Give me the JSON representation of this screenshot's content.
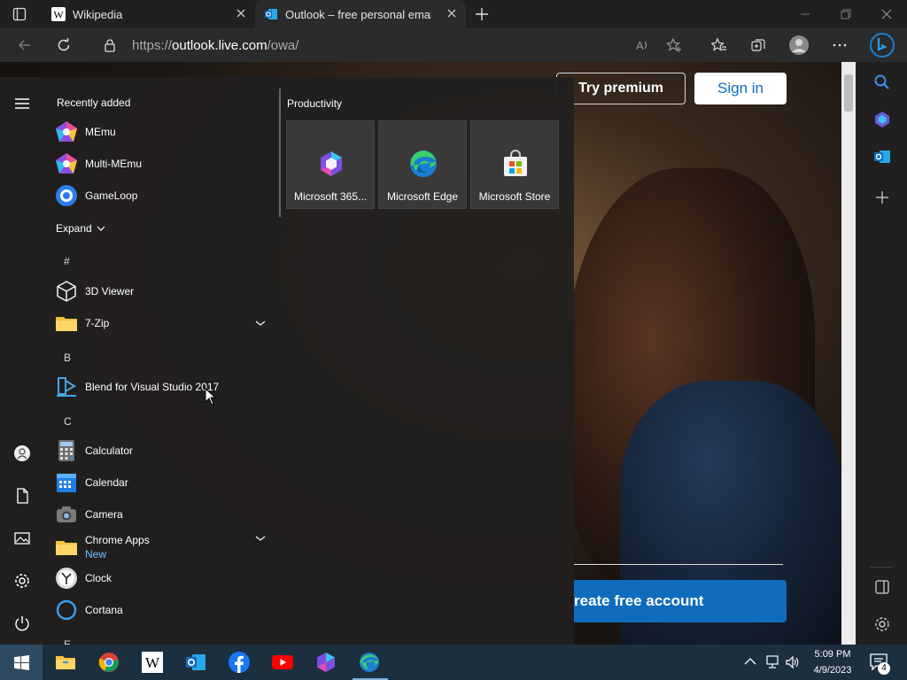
{
  "browser": {
    "tabs": [
      {
        "label": "Wikipedia",
        "active": false
      },
      {
        "label": "Outlook – free personal email an",
        "active": true
      }
    ],
    "url_prefix": "https://",
    "url_domain": "outlook.live.com",
    "url_path": "/owa/"
  },
  "page": {
    "try_premium": "Try premium",
    "sign_in": "Sign in",
    "create_account": "reate free account"
  },
  "start_menu": {
    "recently_added_title": "Recently added",
    "recent_apps": [
      "MEmu",
      "Multi-MEmu",
      "GameLoop"
    ],
    "expand_label": "Expand",
    "letters": {
      "hash": "#",
      "b": "B",
      "c": "C",
      "e": "E"
    },
    "apps": {
      "viewer3d": "3D Viewer",
      "zip7": "7-Zip",
      "blend": "Blend for Visual Studio 2017",
      "calculator": "Calculator",
      "calendar": "Calendar",
      "camera": "Camera",
      "chrome_apps": "Chrome Apps",
      "chrome_apps_badge": "New",
      "clock": "Clock",
      "cortana": "Cortana"
    },
    "productivity_title": "Productivity",
    "tiles": [
      "Microsoft 365...",
      "Microsoft Edge",
      "Microsoft Store"
    ]
  },
  "taskbar": {
    "time": "5:09 PM",
    "date": "4/9/2023",
    "notification_count": "4"
  },
  "colors": {
    "accent": "#0f6cbd",
    "taskbar": "#1c2f3f"
  }
}
